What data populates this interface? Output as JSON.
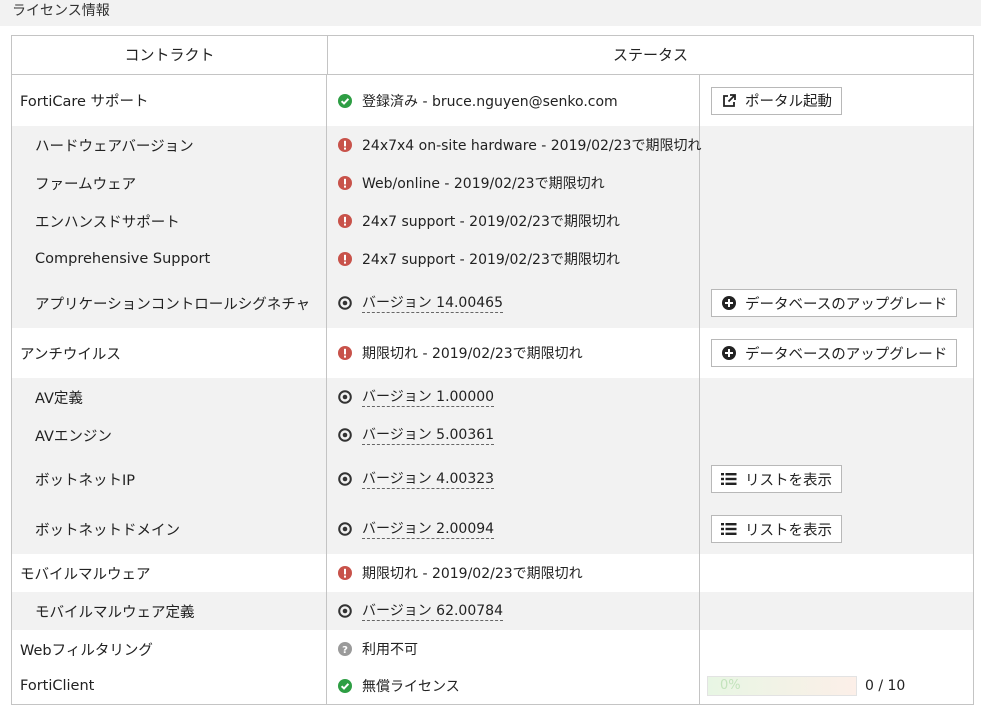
{
  "section_title": "ライセンス情報",
  "columns": {
    "contract": "コントラクト",
    "status": "ステータス"
  },
  "rows": [
    {
      "label": "FortiCare サポート",
      "status_text": "登録済み - bruce.nguyen@senko.com",
      "action": "ポータル起動"
    },
    {
      "label": "ハードウェアバージョン",
      "status_text": "24x7x4 on-site hardware - 2019/02/23で期限切れ"
    },
    {
      "label": "ファームウェア",
      "status_text": "Web/online - 2019/02/23で期限切れ"
    },
    {
      "label": "エンハンスドサポート",
      "status_text": "24x7 support - 2019/02/23で期限切れ"
    },
    {
      "label": "Comprehensive Support",
      "status_text": "24x7 support - 2019/02/23で期限切れ"
    },
    {
      "label": "アプリケーションコントロールシグネチャ",
      "status_text": "バージョン 14.00465",
      "action": "データベースのアップグレード"
    },
    {
      "label": "アンチウイルス",
      "status_text": "期限切れ - 2019/02/23で期限切れ",
      "action": "データベースのアップグレード"
    },
    {
      "label": "AV定義",
      "status_text": "バージョン 1.00000"
    },
    {
      "label": "AVエンジン",
      "status_text": "バージョン 5.00361"
    },
    {
      "label": "ボットネットIP",
      "status_text": "バージョン 4.00323",
      "action": "リストを表示"
    },
    {
      "label": "ボットネットドメイン",
      "status_text": "バージョン 2.00094",
      "action": "リストを表示"
    },
    {
      "label": "モバイルマルウェア",
      "status_text": "期限切れ - 2019/02/23で期限切れ"
    },
    {
      "label": "モバイルマルウェア定義",
      "status_text": "バージョン 62.00784"
    },
    {
      "label": "Webフィルタリング",
      "status_text": "利用不可"
    },
    {
      "label": "FortiClient",
      "status_text": "無償ライセンス",
      "progress": {
        "percent": 0,
        "percent_label": "0%",
        "count_label": "0 / 10"
      }
    }
  ],
  "colors": {
    "ok": "#2e9e44",
    "error": "#c8524a",
    "unknown": "#9a9a9a",
    "version": "#333333",
    "row_alt": "#f2f2f2",
    "border": "#c4c4c4"
  }
}
